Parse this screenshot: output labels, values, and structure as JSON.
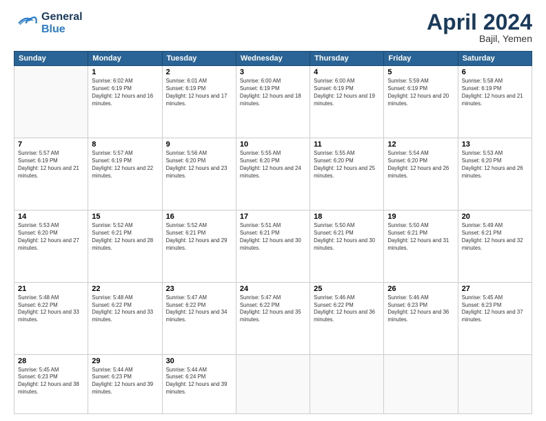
{
  "header": {
    "logo_general": "General",
    "logo_blue": "Blue",
    "month_title": "April 2024",
    "location": "Bajil, Yemen"
  },
  "days_of_week": [
    "Sunday",
    "Monday",
    "Tuesday",
    "Wednesday",
    "Thursday",
    "Friday",
    "Saturday"
  ],
  "weeks": [
    [
      {
        "day": "",
        "sunrise": "",
        "sunset": "",
        "daylight": ""
      },
      {
        "day": "1",
        "sunrise": "Sunrise: 6:02 AM",
        "sunset": "Sunset: 6:19 PM",
        "daylight": "Daylight: 12 hours and 16 minutes."
      },
      {
        "day": "2",
        "sunrise": "Sunrise: 6:01 AM",
        "sunset": "Sunset: 6:19 PM",
        "daylight": "Daylight: 12 hours and 17 minutes."
      },
      {
        "day": "3",
        "sunrise": "Sunrise: 6:00 AM",
        "sunset": "Sunset: 6:19 PM",
        "daylight": "Daylight: 12 hours and 18 minutes."
      },
      {
        "day": "4",
        "sunrise": "Sunrise: 6:00 AM",
        "sunset": "Sunset: 6:19 PM",
        "daylight": "Daylight: 12 hours and 19 minutes."
      },
      {
        "day": "5",
        "sunrise": "Sunrise: 5:59 AM",
        "sunset": "Sunset: 6:19 PM",
        "daylight": "Daylight: 12 hours and 20 minutes."
      },
      {
        "day": "6",
        "sunrise": "Sunrise: 5:58 AM",
        "sunset": "Sunset: 6:19 PM",
        "daylight": "Daylight: 12 hours and 21 minutes."
      }
    ],
    [
      {
        "day": "7",
        "sunrise": "Sunrise: 5:57 AM",
        "sunset": "Sunset: 6:19 PM",
        "daylight": "Daylight: 12 hours and 21 minutes."
      },
      {
        "day": "8",
        "sunrise": "Sunrise: 5:57 AM",
        "sunset": "Sunset: 6:19 PM",
        "daylight": "Daylight: 12 hours and 22 minutes."
      },
      {
        "day": "9",
        "sunrise": "Sunrise: 5:56 AM",
        "sunset": "Sunset: 6:20 PM",
        "daylight": "Daylight: 12 hours and 23 minutes."
      },
      {
        "day": "10",
        "sunrise": "Sunrise: 5:55 AM",
        "sunset": "Sunset: 6:20 PM",
        "daylight": "Daylight: 12 hours and 24 minutes."
      },
      {
        "day": "11",
        "sunrise": "Sunrise: 5:55 AM",
        "sunset": "Sunset: 6:20 PM",
        "daylight": "Daylight: 12 hours and 25 minutes."
      },
      {
        "day": "12",
        "sunrise": "Sunrise: 5:54 AM",
        "sunset": "Sunset: 6:20 PM",
        "daylight": "Daylight: 12 hours and 26 minutes."
      },
      {
        "day": "13",
        "sunrise": "Sunrise: 5:53 AM",
        "sunset": "Sunset: 6:20 PM",
        "daylight": "Daylight: 12 hours and 26 minutes."
      }
    ],
    [
      {
        "day": "14",
        "sunrise": "Sunrise: 5:53 AM",
        "sunset": "Sunset: 6:20 PM",
        "daylight": "Daylight: 12 hours and 27 minutes."
      },
      {
        "day": "15",
        "sunrise": "Sunrise: 5:52 AM",
        "sunset": "Sunset: 6:21 PM",
        "daylight": "Daylight: 12 hours and 28 minutes."
      },
      {
        "day": "16",
        "sunrise": "Sunrise: 5:52 AM",
        "sunset": "Sunset: 6:21 PM",
        "daylight": "Daylight: 12 hours and 29 minutes."
      },
      {
        "day": "17",
        "sunrise": "Sunrise: 5:51 AM",
        "sunset": "Sunset: 6:21 PM",
        "daylight": "Daylight: 12 hours and 30 minutes."
      },
      {
        "day": "18",
        "sunrise": "Sunrise: 5:50 AM",
        "sunset": "Sunset: 6:21 PM",
        "daylight": "Daylight: 12 hours and 30 minutes."
      },
      {
        "day": "19",
        "sunrise": "Sunrise: 5:50 AM",
        "sunset": "Sunset: 6:21 PM",
        "daylight": "Daylight: 12 hours and 31 minutes."
      },
      {
        "day": "20",
        "sunrise": "Sunrise: 5:49 AM",
        "sunset": "Sunset: 6:21 PM",
        "daylight": "Daylight: 12 hours and 32 minutes."
      }
    ],
    [
      {
        "day": "21",
        "sunrise": "Sunrise: 5:48 AM",
        "sunset": "Sunset: 6:22 PM",
        "daylight": "Daylight: 12 hours and 33 minutes."
      },
      {
        "day": "22",
        "sunrise": "Sunrise: 5:48 AM",
        "sunset": "Sunset: 6:22 PM",
        "daylight": "Daylight: 12 hours and 33 minutes."
      },
      {
        "day": "23",
        "sunrise": "Sunrise: 5:47 AM",
        "sunset": "Sunset: 6:22 PM",
        "daylight": "Daylight: 12 hours and 34 minutes."
      },
      {
        "day": "24",
        "sunrise": "Sunrise: 5:47 AM",
        "sunset": "Sunset: 6:22 PM",
        "daylight": "Daylight: 12 hours and 35 minutes."
      },
      {
        "day": "25",
        "sunrise": "Sunrise: 5:46 AM",
        "sunset": "Sunset: 6:22 PM",
        "daylight": "Daylight: 12 hours and 36 minutes."
      },
      {
        "day": "26",
        "sunrise": "Sunrise: 5:46 AM",
        "sunset": "Sunset: 6:23 PM",
        "daylight": "Daylight: 12 hours and 36 minutes."
      },
      {
        "day": "27",
        "sunrise": "Sunrise: 5:45 AM",
        "sunset": "Sunset: 6:23 PM",
        "daylight": "Daylight: 12 hours and 37 minutes."
      }
    ],
    [
      {
        "day": "28",
        "sunrise": "Sunrise: 5:45 AM",
        "sunset": "Sunset: 6:23 PM",
        "daylight": "Daylight: 12 hours and 38 minutes."
      },
      {
        "day": "29",
        "sunrise": "Sunrise: 5:44 AM",
        "sunset": "Sunset: 6:23 PM",
        "daylight": "Daylight: 12 hours and 39 minutes."
      },
      {
        "day": "30",
        "sunrise": "Sunrise: 5:44 AM",
        "sunset": "Sunset: 6:24 PM",
        "daylight": "Daylight: 12 hours and 39 minutes."
      },
      {
        "day": "",
        "sunrise": "",
        "sunset": "",
        "daylight": ""
      },
      {
        "day": "",
        "sunrise": "",
        "sunset": "",
        "daylight": ""
      },
      {
        "day": "",
        "sunrise": "",
        "sunset": "",
        "daylight": ""
      },
      {
        "day": "",
        "sunrise": "",
        "sunset": "",
        "daylight": ""
      }
    ]
  ]
}
